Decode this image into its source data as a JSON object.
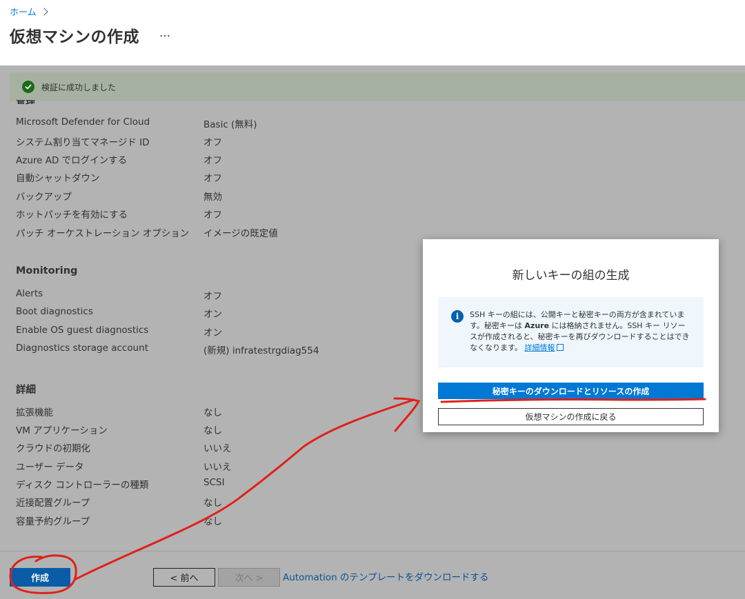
{
  "header": {
    "breadcrumb_home": "ホーム",
    "title": "仮想マシンの作成",
    "more": "…"
  },
  "banner": {
    "icon": "checkmark-circle-icon",
    "text": "検証に成功しました"
  },
  "settings_rows": [
    {
      "label": "Microsoft Defender for Cloud",
      "value": "Basic (無料)"
    },
    {
      "label": "システム割り当てマネージド ID",
      "value": "オフ"
    },
    {
      "label": "Azure AD でログインする",
      "value": "オフ"
    },
    {
      "label": "自動シャットダウン",
      "value": "オフ"
    },
    {
      "label": "バックアップ",
      "value": "無効"
    },
    {
      "label": "ホットパッチを有効にする",
      "value": "オフ"
    },
    {
      "label": "パッチ オーケストレーション オプション",
      "value": "イメージの既定値"
    }
  ],
  "monitoring": {
    "heading": "Monitoring",
    "rows": [
      {
        "label": "Alerts",
        "value": "オフ"
      },
      {
        "label": "Boot diagnostics",
        "value": "オン"
      },
      {
        "label": "Enable OS guest diagnostics",
        "value": "オン"
      },
      {
        "label": "Diagnostics storage account",
        "value": "(新規) infratestrgdiag554"
      }
    ]
  },
  "details": {
    "heading": "詳細",
    "rows": [
      {
        "label": "拡張機能",
        "value": "なし"
      },
      {
        "label": "VM アプリケーション",
        "value": "なし"
      },
      {
        "label": "クラウドの初期化",
        "value": "いいえ"
      },
      {
        "label": "ユーザー データ",
        "value": "いいえ"
      },
      {
        "label": "ディスク コントローラーの種類",
        "value": "SCSI"
      },
      {
        "label": "近接配置グループ",
        "value": "なし"
      },
      {
        "label": "容量予約グループ",
        "value": "なし"
      }
    ]
  },
  "footer": {
    "create": "作成",
    "prev": "< 前へ",
    "next": "次へ >",
    "template_link": "Automation のテンプレートをダウンロードする"
  },
  "dialog": {
    "title": "新しいキーの組の生成",
    "info_icon": "info-icon",
    "info_part1": "SSH キーの組には、公開キーと秘密キーの両方が含まれています。秘密キーは ",
    "info_bold": "Azure",
    "info_part2": " には格納されません。SSH キー リソースが作成されると、秘密キーを再びダウンロードすることはできなくなります。",
    "info_link": "詳細情報",
    "download_button": "秘密キーのダウンロードとリソースの作成",
    "back_button": "仮想マシンの作成に戻る"
  },
  "colors": {
    "accent": "#0078d4",
    "success": "#107c10",
    "annotation": "#e0201a"
  }
}
